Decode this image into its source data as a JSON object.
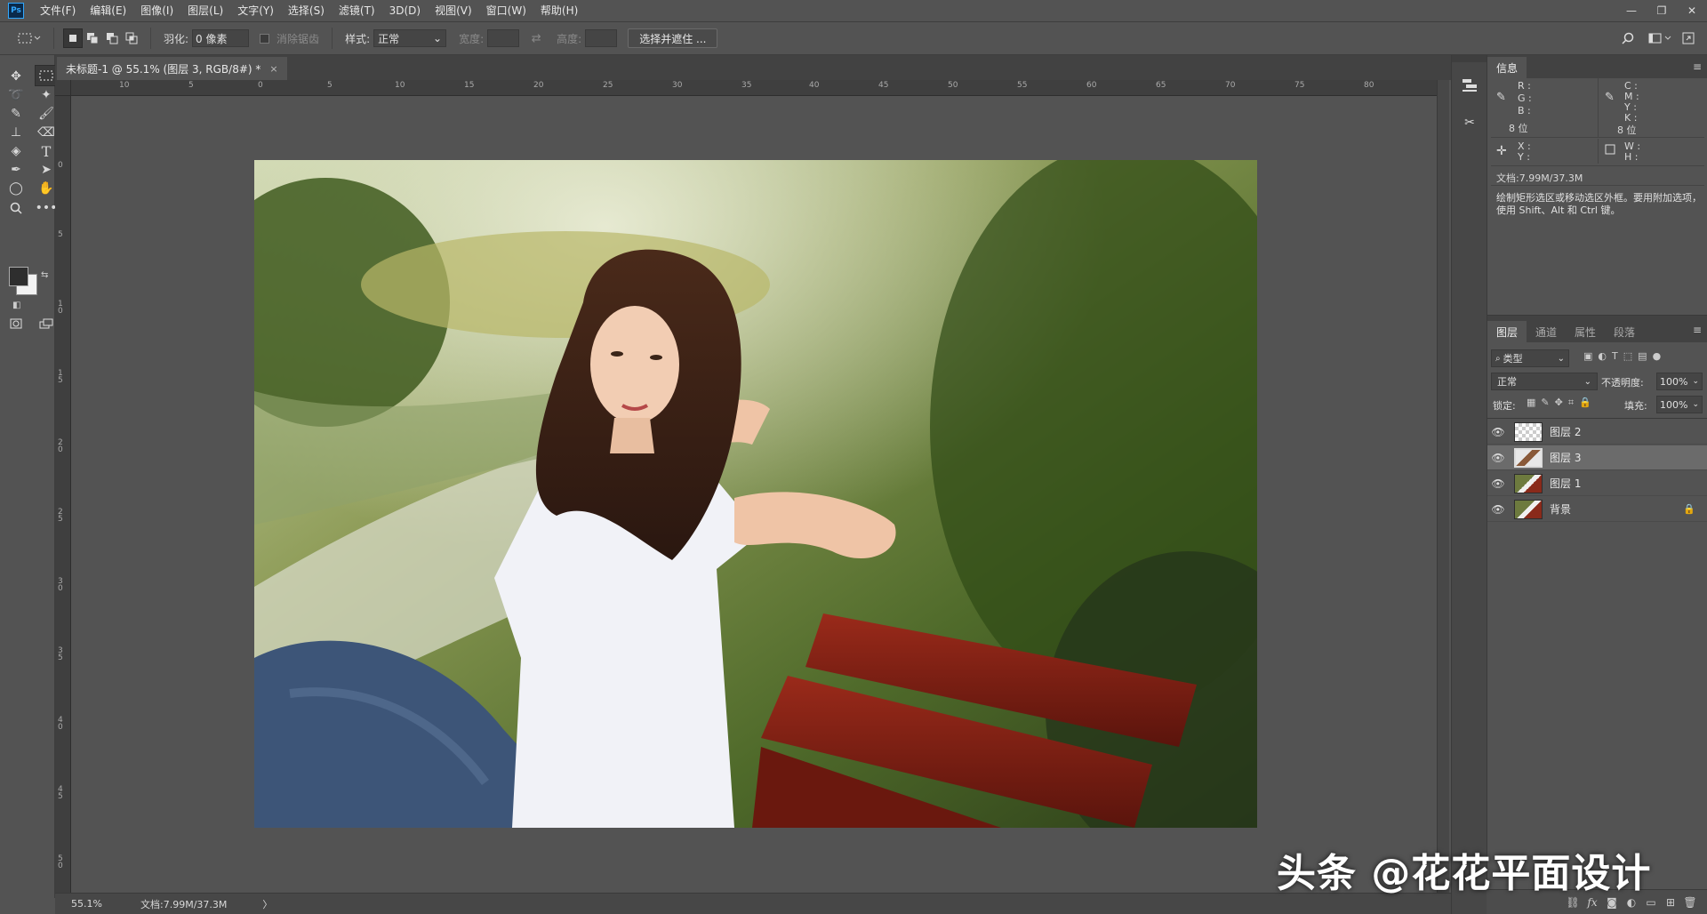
{
  "menubar": {
    "logo": "Ps",
    "items": [
      "文件(F)",
      "编辑(E)",
      "图像(I)",
      "图层(L)",
      "文字(Y)",
      "选择(S)",
      "滤镜(T)",
      "3D(D)",
      "视图(V)",
      "窗口(W)",
      "帮助(H)"
    ],
    "window_controls": [
      "—",
      "❐",
      "✕"
    ]
  },
  "options": {
    "feather_label": "羽化:",
    "feather_value": "0 像素",
    "antialias_label": "消除锯齿",
    "style_label": "样式:",
    "style_value": "正常",
    "width_label": "宽度:",
    "height_label": "高度:",
    "select_mask_button": "选择并遮住 ..."
  },
  "document": {
    "tab_title": "未标题-1 @ 55.1% (图层 3, RGB/8#) *",
    "tab_close": "×",
    "zoom": "55.1%",
    "doc_size": "文档:7.99M/37.3M",
    "status_arrow": "〉"
  },
  "rulers": {
    "top_labels": [
      "10",
      "5",
      "0",
      "5",
      "10",
      "15",
      "20",
      "25",
      "30",
      "35",
      "40",
      "45",
      "50",
      "55",
      "60",
      "65",
      "70",
      "75",
      "80"
    ],
    "left_labels": [
      "0",
      "5",
      "1 0",
      "1 5",
      "2 0",
      "2 5",
      "3 0",
      "3 5",
      "4 0",
      "4 5",
      "5 0"
    ]
  },
  "info_panel": {
    "tab": "信息",
    "menu": "≡",
    "r": "R :",
    "g": "G :",
    "b": "B :",
    "c": "C :",
    "m": "M :",
    "y": "Y :",
    "k": "K :",
    "bits_left": "8 位",
    "bits_right": "8 位",
    "x": "X :",
    "y_coord": "Y :",
    "w": "W :",
    "h": "H :",
    "doc_size": "文档:7.99M/37.3M",
    "description": "绘制矩形选区或移动选区外框。要用附加选项，使用 Shift、Alt 和 Ctrl 键。"
  },
  "layers_panel": {
    "tabs": [
      "图层",
      "通道",
      "属性",
      "段落"
    ],
    "menu": "≡",
    "filter_kind": "类型",
    "blend_mode": "正常",
    "opacity_label": "不透明度:",
    "opacity_value": "100%",
    "lock_label": "锁定:",
    "fill_label": "填充:",
    "fill_value": "100%",
    "layers": [
      {
        "name": "图层 2",
        "selected": false,
        "locked": false
      },
      {
        "name": "图层 3",
        "selected": true,
        "locked": false
      },
      {
        "name": "图层 1",
        "selected": false,
        "locked": false
      },
      {
        "name": "背景",
        "selected": false,
        "locked": true
      }
    ],
    "footer_icons": [
      "link-icon",
      "fx-icon",
      "mask-icon",
      "adjustment-icon",
      "group-icon",
      "new-layer-icon",
      "trash-icon"
    ]
  },
  "watermark": "头条 @花花平面设计",
  "colors": {
    "ui_bg": "#535353",
    "panel_dark": "#424242",
    "selected_layer": "#6b6b6b",
    "ps_blue": "#31a8ff"
  }
}
